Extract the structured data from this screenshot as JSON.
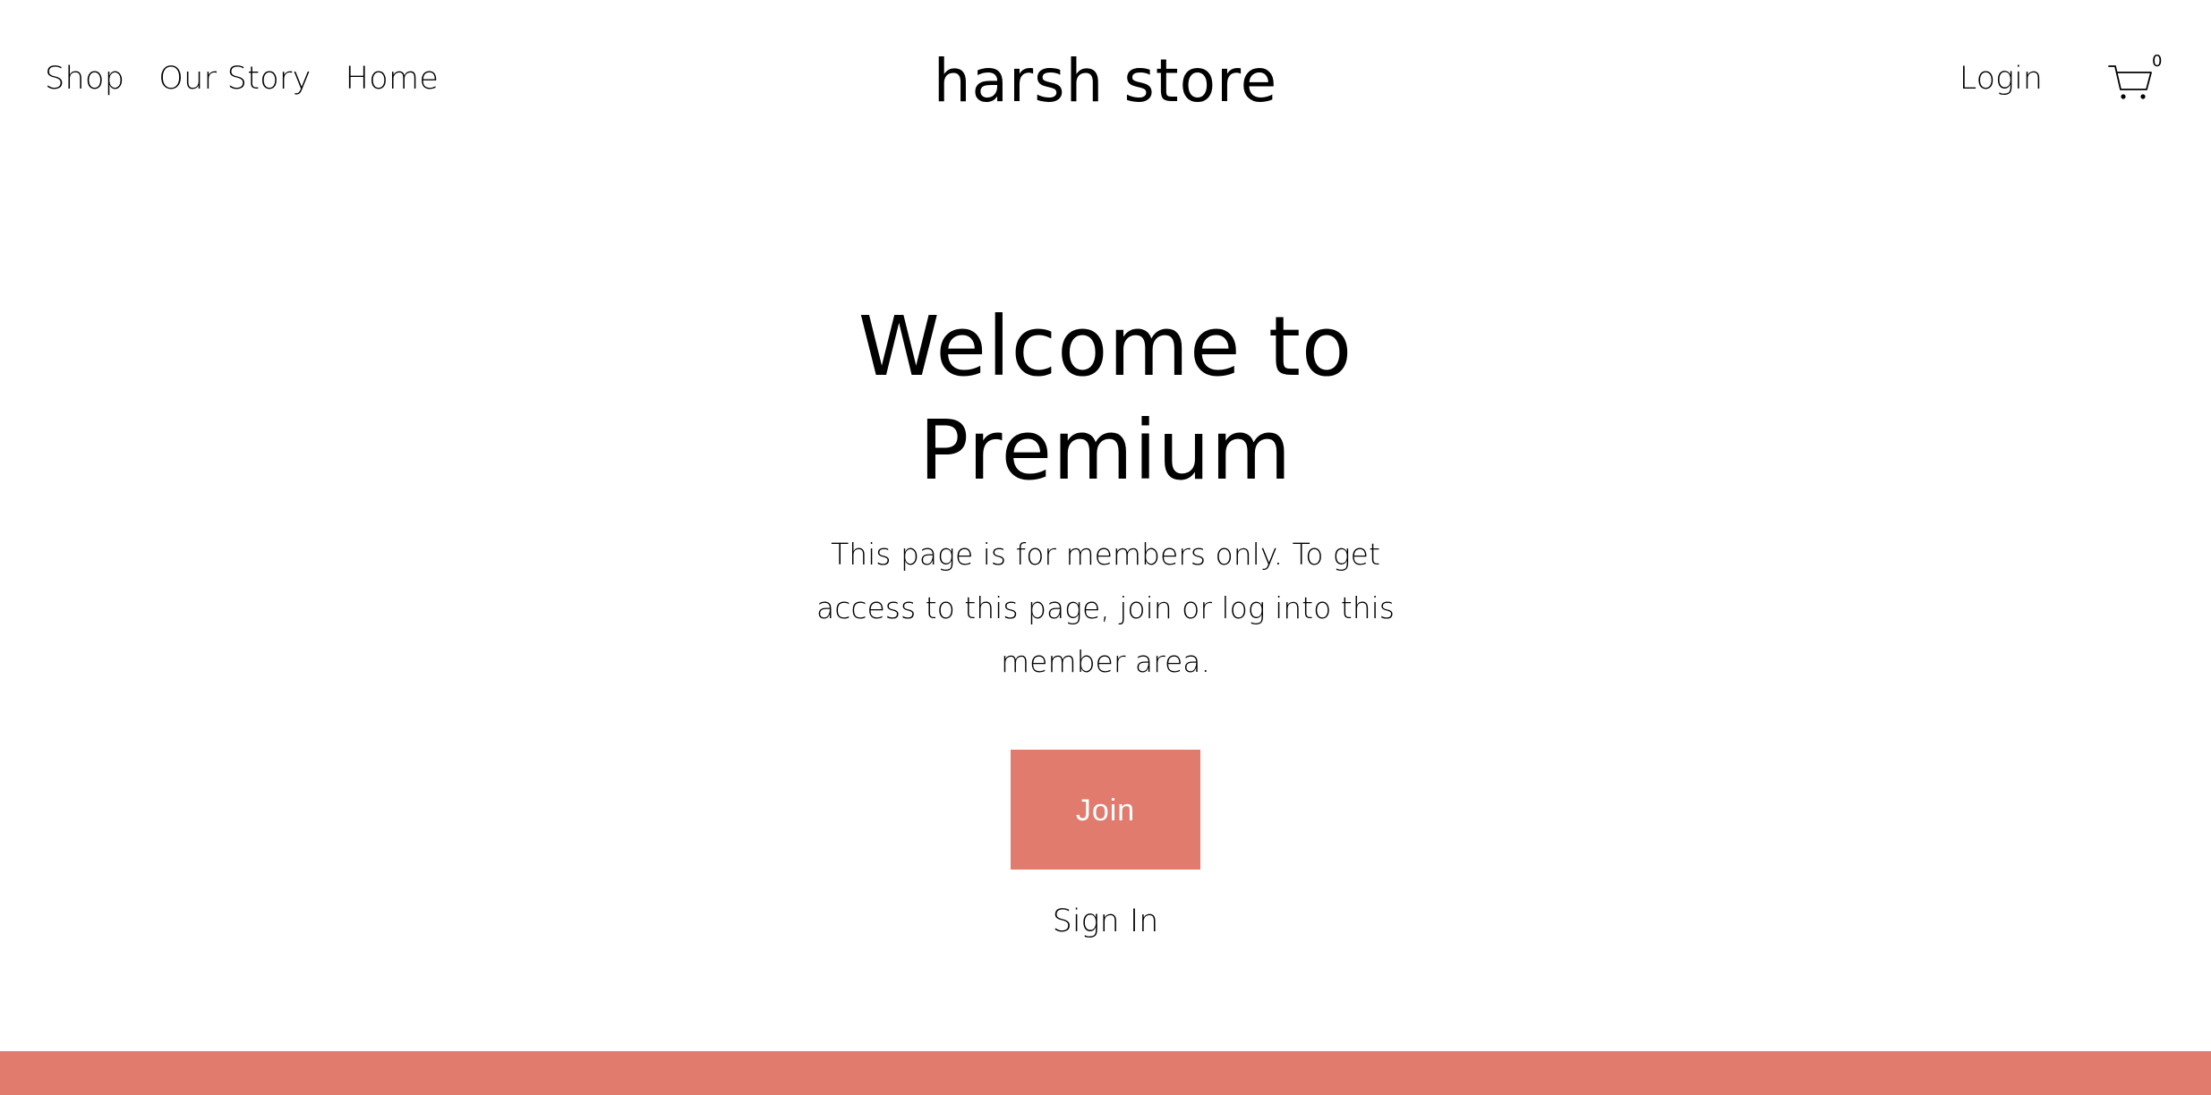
{
  "header": {
    "nav": [
      "Shop",
      "Our Story",
      "Home"
    ],
    "brand": "harsh store",
    "login_label": "Login",
    "cart_count": "0",
    "cart_icon": "shopping-cart-icon"
  },
  "main": {
    "title_line1": "Welcome to",
    "title_line2": "Premium",
    "description": "This page is for members only. To get access to this page, join or log into this member area.",
    "join_label": "Join",
    "signin_label": "Sign In"
  },
  "colors": {
    "accent": "#e07b6e",
    "text": "#000000",
    "background": "#ffffff"
  }
}
